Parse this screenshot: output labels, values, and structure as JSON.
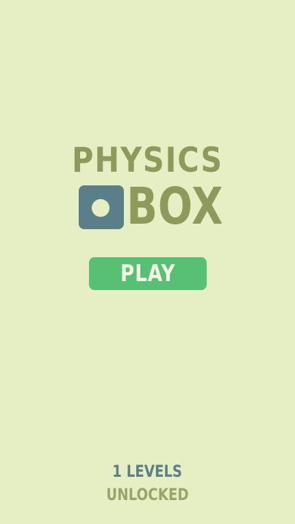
{
  "title": {
    "line1": "PHYSICS",
    "line2": "BOX"
  },
  "logo_icon": "square-with-dot-icon",
  "play_label": "PLAY",
  "levels": {
    "count_text": "1 LEVELS",
    "status_text": "UNLOCKED"
  },
  "colors": {
    "background": "#e6efc3",
    "title": "#8e9a5c",
    "logo_box": "#5b7f88",
    "play_button": "#57c072",
    "levels_count": "#5b7f88",
    "levels_label": "#9aa46a"
  }
}
